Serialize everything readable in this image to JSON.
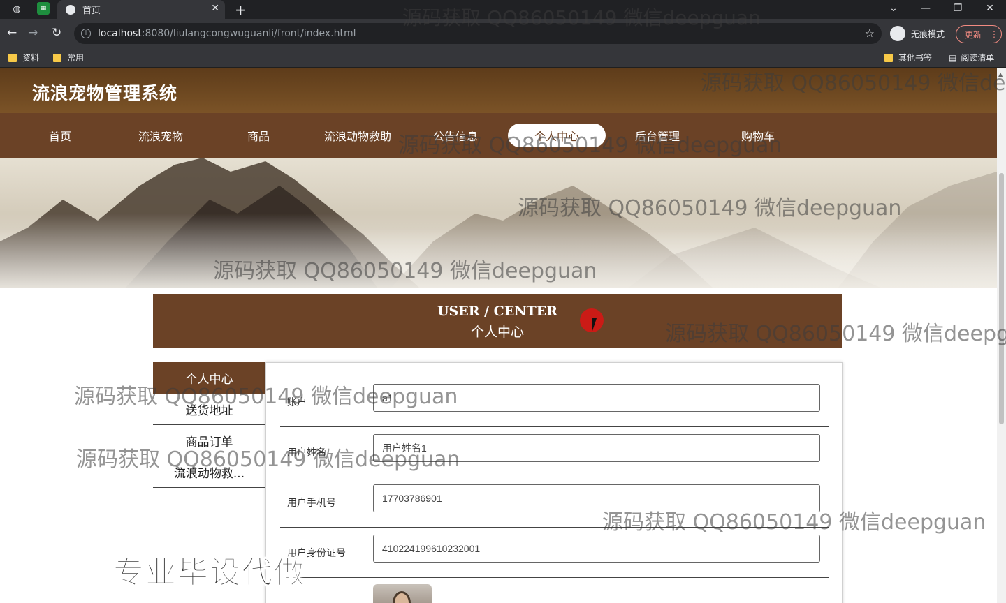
{
  "browser": {
    "tab_title": "首页",
    "url_host": "localhost",
    "url_path": ":8080/liulangcongwuguanli/front/index.html",
    "incognito_label": "无痕模式",
    "update_label": "更新",
    "bookmarks": [
      "资料",
      "常用"
    ],
    "bookmarks_right": [
      "其他书签",
      "阅读清单"
    ]
  },
  "site": {
    "title": "流浪宠物管理系统",
    "nav": [
      "首页",
      "流浪宠物",
      "商品",
      "流浪动物救助",
      "公告信息",
      "个人中心",
      "后台管理",
      "购物车"
    ],
    "active_nav": "个人中心"
  },
  "user_center": {
    "heading_en": "USER / CENTER",
    "heading_zh": "个人中心",
    "side_menu": [
      "个人中心",
      "送货地址",
      "商品订单",
      "流浪动物救..."
    ],
    "fields": [
      {
        "label": "账户",
        "value": "a1"
      },
      {
        "label": "用户姓名",
        "value": "用户姓名1"
      },
      {
        "label": "用户手机号",
        "value": "17703786901"
      },
      {
        "label": "用户身份证号",
        "value": "410224199610232001"
      }
    ]
  },
  "watermarks": {
    "text": "源码获取 QQ86050149 微信deepguan",
    "text_cut_1": "源码获取 QQ86050149 微信dee",
    "text_cut_2": "源码获取 QQ86050149 微信deepgu",
    "promo": "专业毕设代做"
  },
  "colors": {
    "brand_brown": "#6b4226",
    "header_brown": "#7b5327",
    "browser_dark": "#202124",
    "update_red": "#f28b82"
  }
}
